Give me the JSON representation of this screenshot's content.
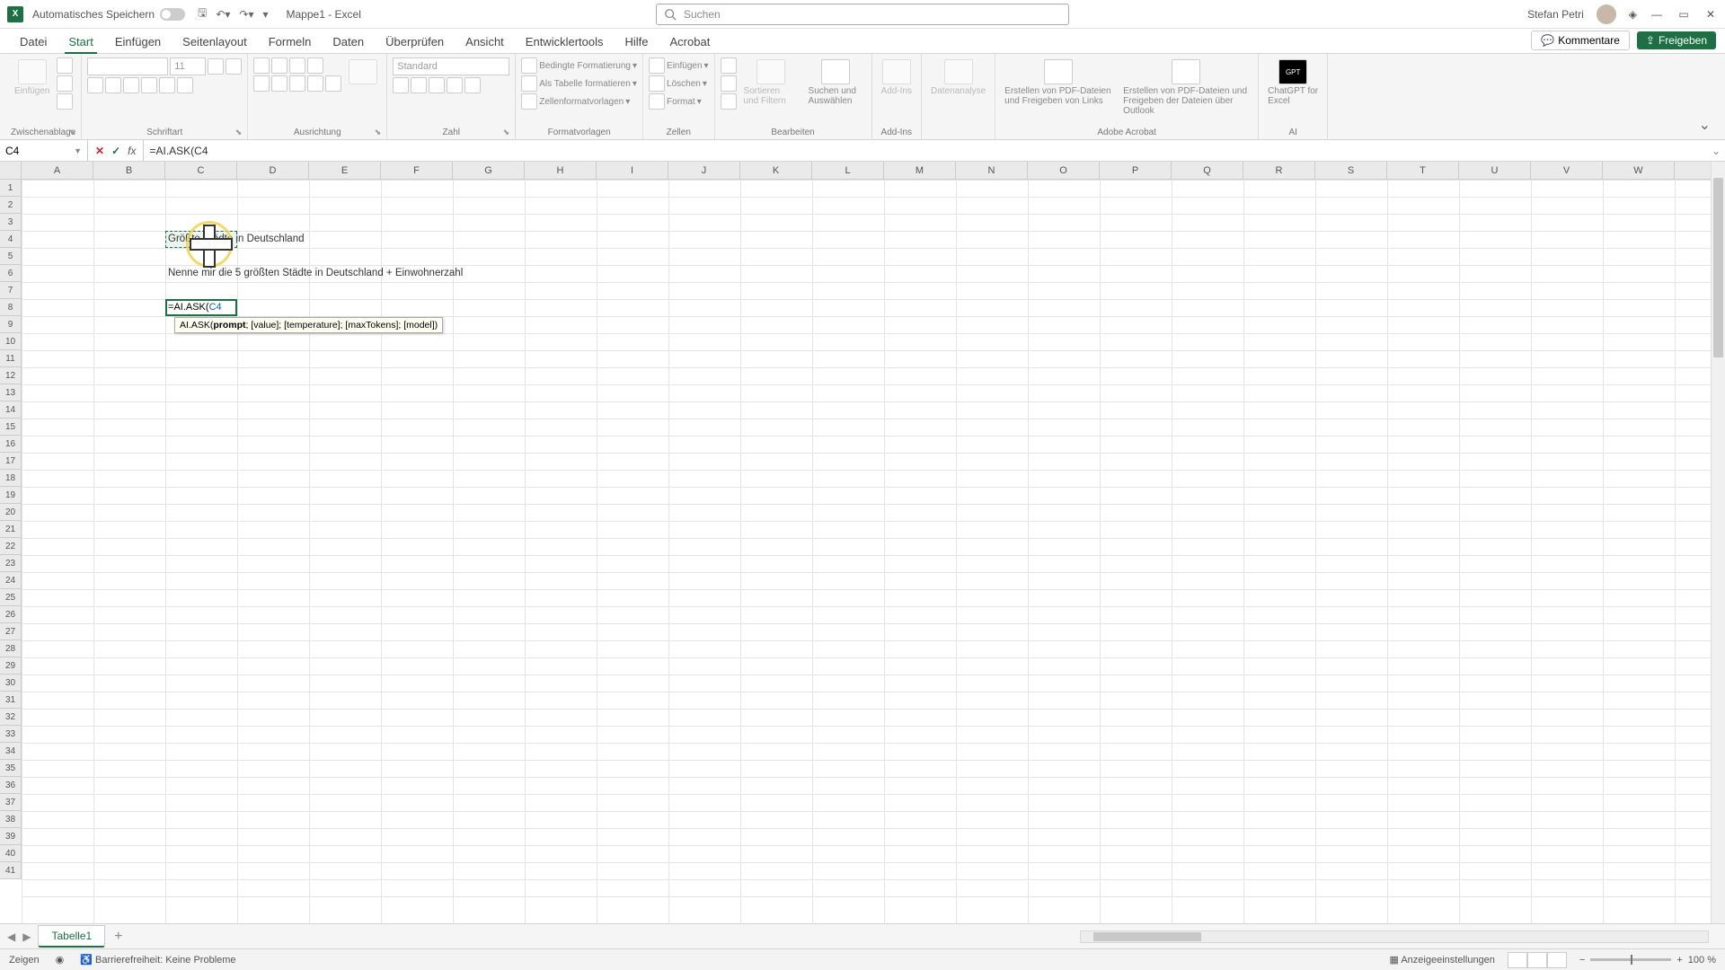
{
  "titlebar": {
    "autosave_label": "Automatisches Speichern",
    "doc_name": "Mappe1 - Excel",
    "search_placeholder": "Suchen",
    "user_name": "Stefan Petri"
  },
  "tabs": {
    "datei": "Datei",
    "start": "Start",
    "einfuegen": "Einfügen",
    "seitenlayout": "Seitenlayout",
    "formeln": "Formeln",
    "daten": "Daten",
    "ueberpruefen": "Überprüfen",
    "ansicht": "Ansicht",
    "entwicklertools": "Entwicklertools",
    "hilfe": "Hilfe",
    "acrobat": "Acrobat",
    "kommentare": "Kommentare",
    "freigeben": "Freigeben"
  },
  "ribbon": {
    "einfuegen": "Einfügen",
    "zwischenablage": "Zwischenablage",
    "schriftart": "Schriftart",
    "ausrichtung": "Ausrichtung",
    "zahl": "Zahl",
    "standard": "Standard",
    "bedingte": "Bedingte Formatierung",
    "tabelle": "Als Tabelle formatieren",
    "zellen_f": "Zellenformatvorlagen",
    "formatvorlagen": "Formatvorlagen",
    "zellen_einf": "Einfügen",
    "loeschen": "Löschen",
    "format": "Format",
    "zellen": "Zellen",
    "sortieren": "Sortieren und Filtern",
    "suchen": "Suchen und Auswählen",
    "bearbeiten": "Bearbeiten",
    "addins_btn": "Add-Ins",
    "addins": "Add-Ins",
    "datenanalyse": "Datenanalyse",
    "pdf1": "Erstellen von PDF-Dateien und Freigeben von Links",
    "pdf2": "Erstellen von PDF-Dateien und Freigeben der Dateien über Outlook",
    "adobe": "Adobe Acrobat",
    "gpt": "ChatGPT for Excel",
    "ai": "AI",
    "font_size": "11"
  },
  "namebox": {
    "cell": "C4"
  },
  "formula": "=AI.ASK(C4",
  "cells": {
    "c4": "Größte Städte in Deutschland",
    "c6": "Nenne mir die 5 größten Städte in Deutschland + Einwohnerzahl",
    "c8_eq": "=",
    "c8_fn": "AI.ASK(",
    "c8_ref": "C4"
  },
  "tooltip": "AI.ASK(prompt; [value]; [temperature]; [maxTokens]; [model])",
  "columns": [
    "A",
    "B",
    "C",
    "D",
    "E",
    "F",
    "G",
    "H",
    "I",
    "J",
    "K",
    "L",
    "M",
    "N",
    "O",
    "P",
    "Q",
    "R",
    "S",
    "T",
    "U",
    "V",
    "W"
  ],
  "rows": [
    "1",
    "2",
    "3",
    "4",
    "5",
    "6",
    "7",
    "8",
    "9",
    "10",
    "11",
    "12",
    "13",
    "14",
    "15",
    "16",
    "17",
    "18",
    "19",
    "20",
    "21",
    "22",
    "23",
    "24",
    "25",
    "26",
    "27",
    "28",
    "29",
    "30",
    "31",
    "32",
    "33",
    "34",
    "35",
    "36",
    "37",
    "38",
    "39",
    "40",
    "41"
  ],
  "sheets": {
    "sheet1": "Tabelle1"
  },
  "status": {
    "mode": "Zeigen",
    "access": "Barrierefreiheit: Keine Probleme",
    "display": "Anzeigeeinstellungen",
    "zoom": "100 %"
  }
}
